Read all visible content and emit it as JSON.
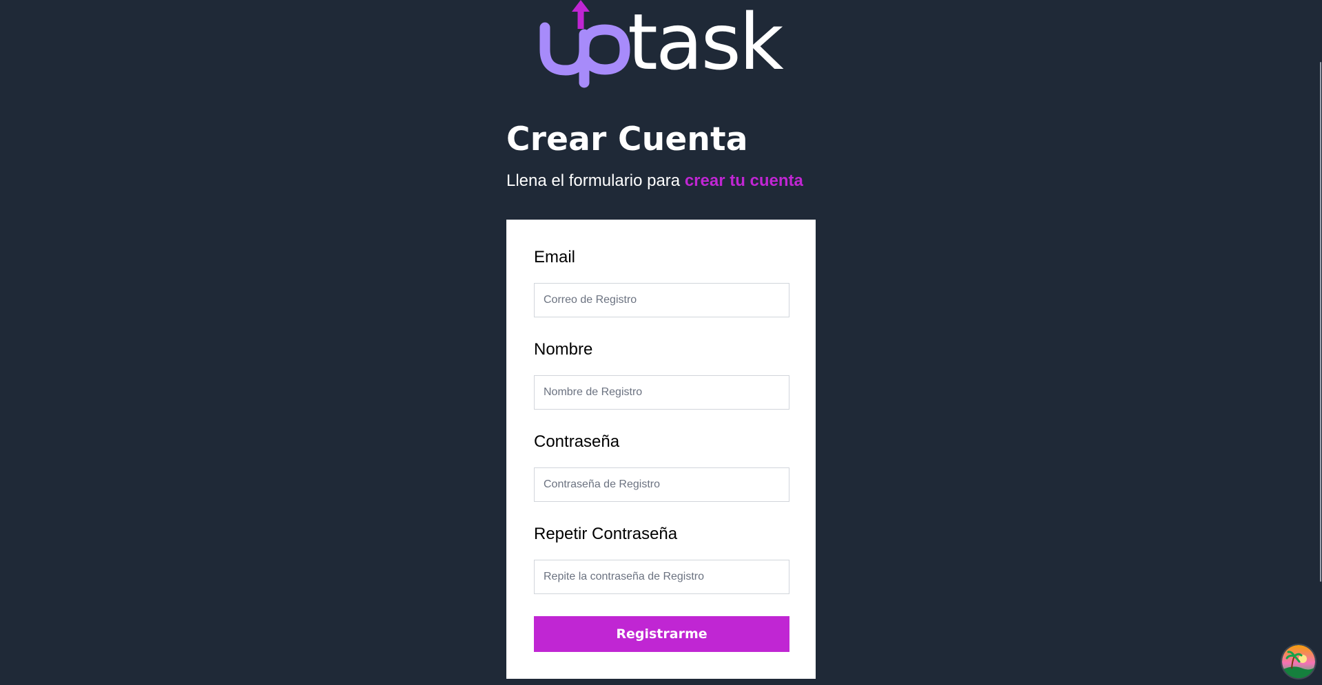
{
  "logo": {
    "text": "uptask",
    "colors": {
      "up": "#a78bfa",
      "arrow": "#c026d3",
      "task": "#ffffff"
    }
  },
  "heading": {
    "title": "Crear Cuenta",
    "subtitle_plain": "Llena el formulario para ",
    "subtitle_accent": "crear tu cuenta"
  },
  "form": {
    "fields": [
      {
        "label": "Email",
        "placeholder": "Correo de Registro",
        "value": ""
      },
      {
        "label": "Nombre",
        "placeholder": "Nombre de Registro",
        "value": ""
      },
      {
        "label": "Contraseña",
        "placeholder": "Contraseña de Registro",
        "value": ""
      },
      {
        "label": "Repetir Contraseña",
        "placeholder": "Repite la contraseña de Registro",
        "value": ""
      }
    ],
    "submit_label": "Registrarme"
  },
  "colors": {
    "background": "#1f2937",
    "accent": "#c026d3",
    "card": "#ffffff"
  },
  "icons": {
    "corner": "profile-avatar-icon"
  }
}
